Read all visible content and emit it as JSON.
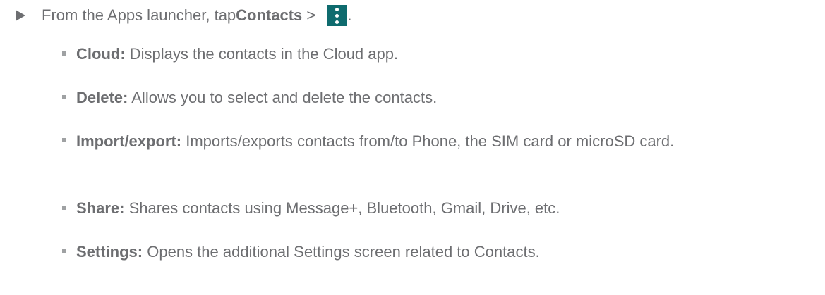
{
  "step": {
    "prefix": "From the Apps launcher, tap ",
    "bold": "Contacts",
    "suffix": " > ",
    "icon": "more-vertical-icon",
    "icon_color": "#0e6b6e",
    "end": "."
  },
  "items": [
    {
      "term": "Cloud:",
      "text": " Displays the contacts in the Cloud app."
    },
    {
      "term": "Delete:",
      "text": " Allows you to select and delete the contacts."
    },
    {
      "term": "Import/export:",
      "text": " Imports/exports contacts from/to Phone, the SIM card or microSD card."
    },
    {
      "term": "Share:",
      "text": " Shares contacts using Message+, Bluetooth, Gmail, Drive, etc."
    },
    {
      "term": "Settings:",
      "text": " Opens the additional Settings screen related to Contacts."
    }
  ],
  "colors": {
    "text": "#6d6e71",
    "bullet": "#9fa1a3"
  }
}
